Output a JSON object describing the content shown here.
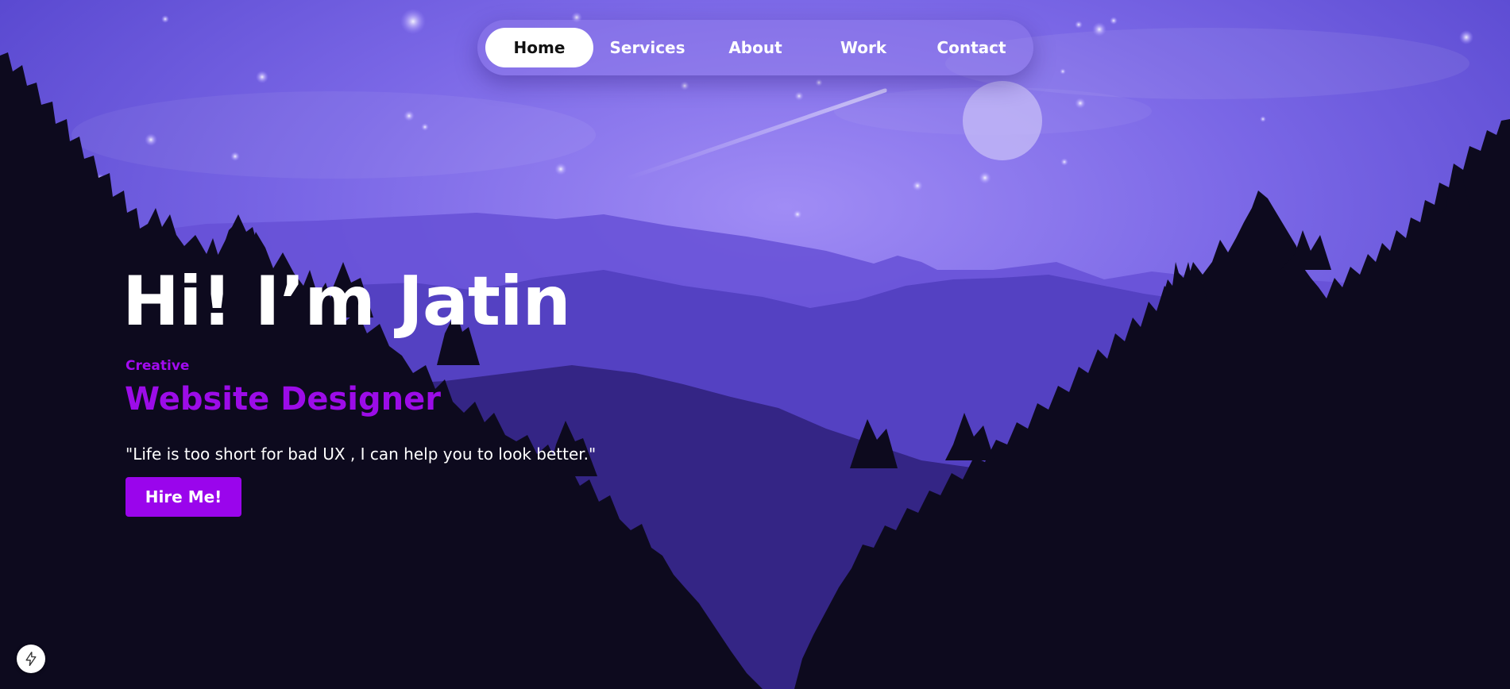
{
  "nav": {
    "items": [
      {
        "label": "Home",
        "active": true
      },
      {
        "label": "Services",
        "active": false
      },
      {
        "label": "About",
        "active": false
      },
      {
        "label": "Work",
        "active": false
      },
      {
        "label": "Contact",
        "active": false
      }
    ]
  },
  "hero": {
    "title": "Hi! I’m Jatin",
    "eyebrow": "Creative",
    "role": "Website Designer",
    "quote": "\"Life is too short for bad UX , I can help you to look better.\"",
    "cta_label": "Hire Me!"
  },
  "colors": {
    "accent": "#9a05ec",
    "sky_top": "#5c4bd6",
    "sky_glow": "#a08cf5",
    "forest": "#0d0a1e"
  },
  "icons": {
    "fab": "lightning-bolt-icon"
  }
}
